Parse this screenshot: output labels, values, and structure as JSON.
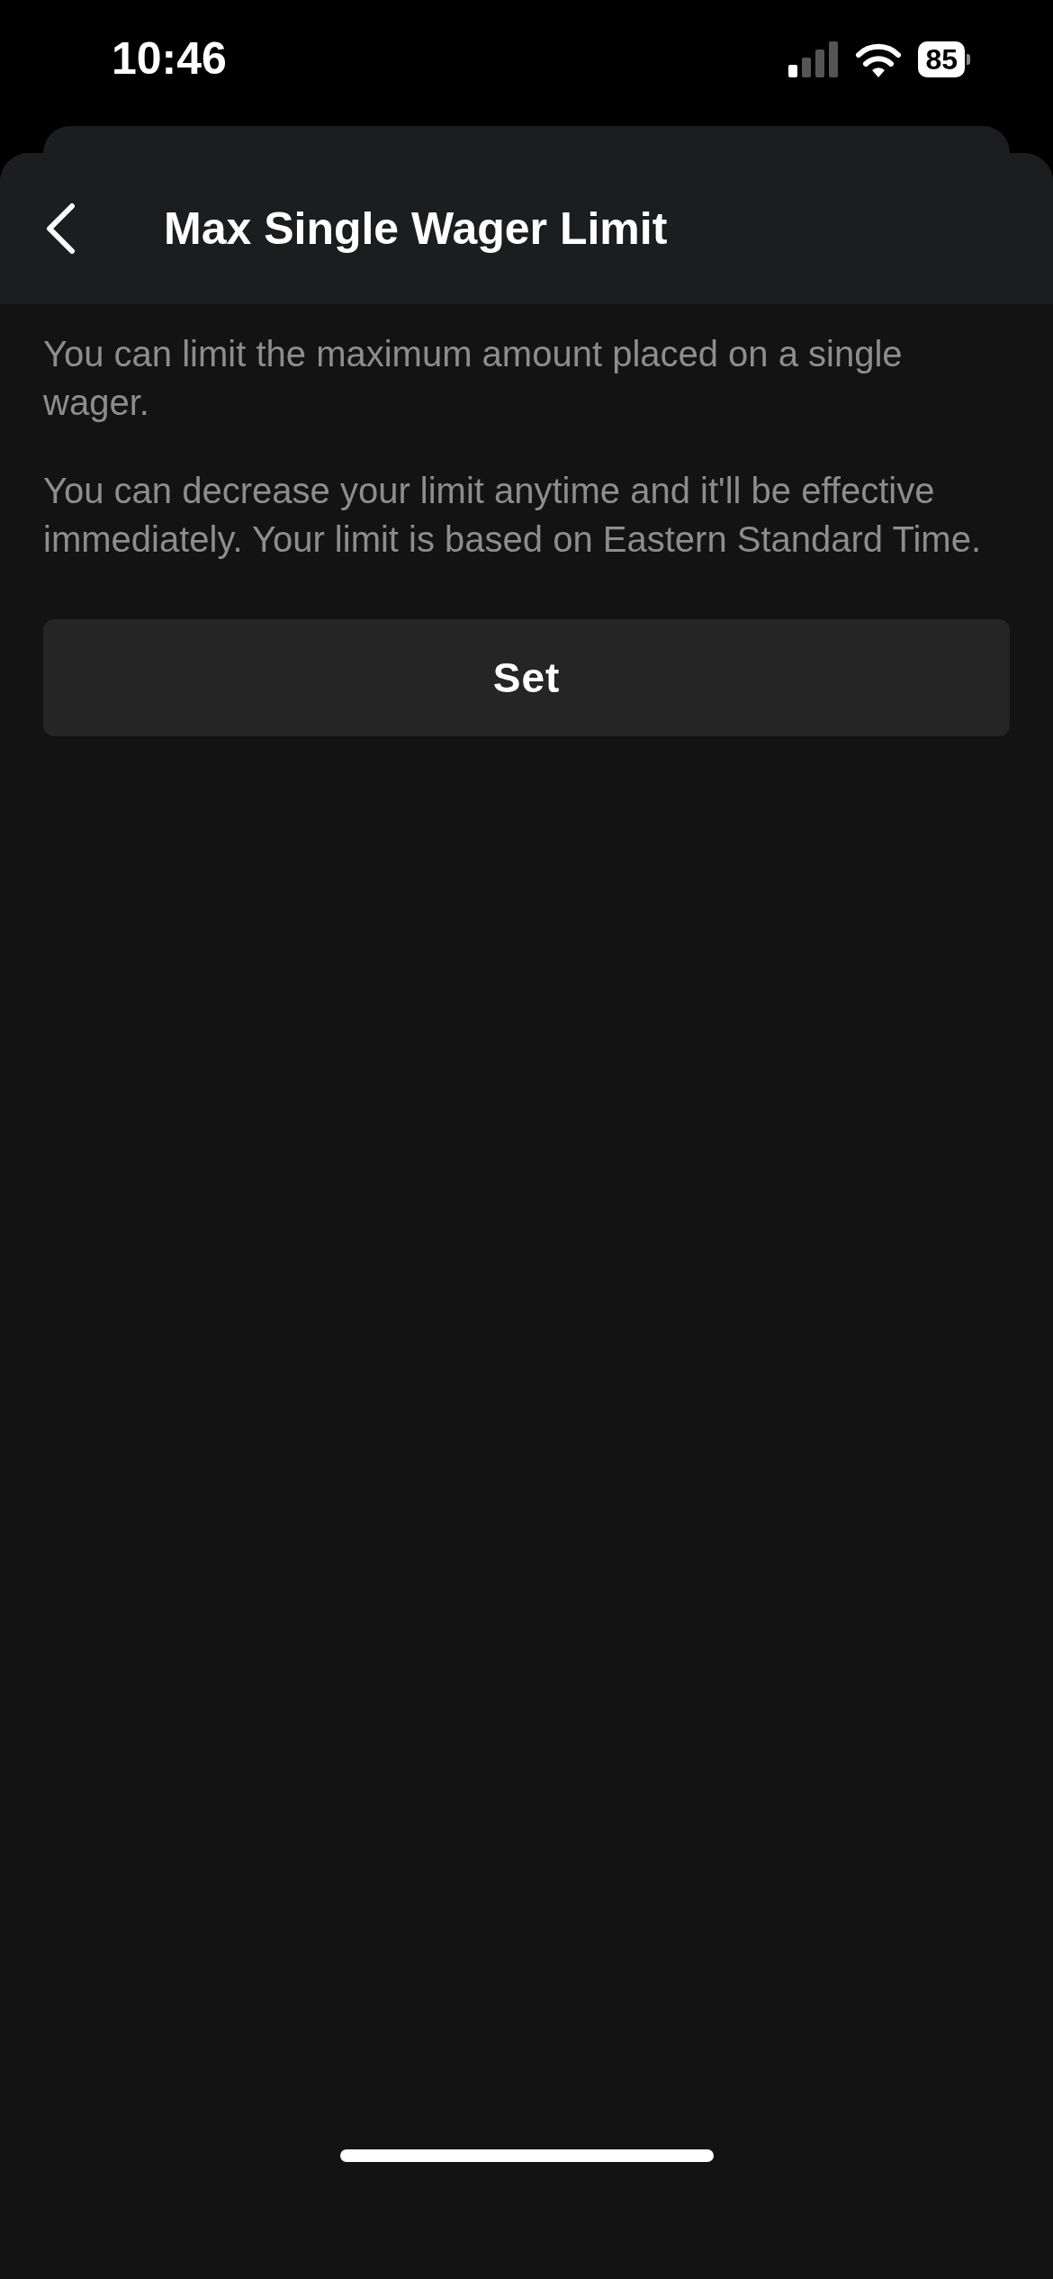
{
  "status_bar": {
    "time": "10:46",
    "battery": "85"
  },
  "header": {
    "title": "Max Single Wager Limit"
  },
  "paragraphs": [
    "You can limit the maximum amount placed on a single wager.",
    "You can decrease your limit anytime and it'll be effective immediately. Your limit is based on Eastern Standard Time."
  ],
  "button": {
    "label": "Set"
  }
}
